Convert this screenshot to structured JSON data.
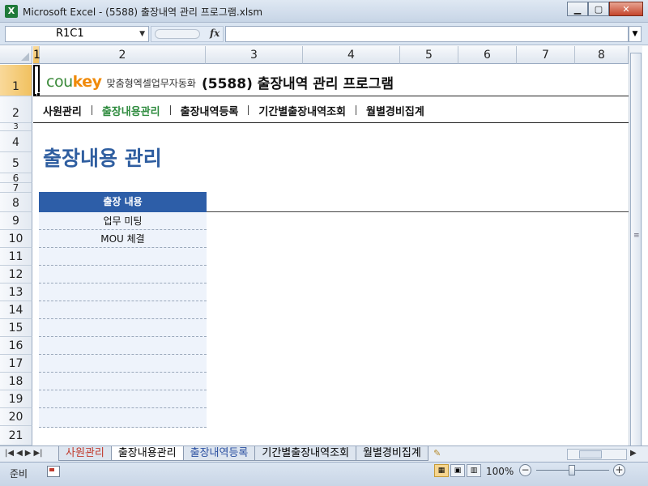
{
  "window": {
    "title": "Microsoft Excel - (5588) 출장내역 관리 프로그램.xlsm",
    "app_icon": "X",
    "min_glyph": "▁",
    "max_glyph": "▢",
    "close_glyph": "✕"
  },
  "formula_bar": {
    "name_box": "R1C1",
    "fx_label": "fx",
    "formula": ""
  },
  "columns": [
    "1",
    "2",
    "3",
    "4",
    "5",
    "6",
    "7",
    "8"
  ],
  "rows": [
    "1",
    "2",
    "3",
    "4",
    "5",
    "6",
    "7",
    "8",
    "9",
    "10",
    "11",
    "12",
    "13",
    "14",
    "15",
    "16",
    "17",
    "18",
    "19",
    "20",
    "21"
  ],
  "header": {
    "logo_cou": "cou",
    "logo_key": "key",
    "logo_tagline": "맞춤형엑셀업무자동화",
    "program_title": "(5588) 출장내역 관리 프로그램"
  },
  "menu": {
    "items": [
      {
        "label": "사원관리",
        "active": false
      },
      {
        "label": "출장내용관리",
        "active": true
      },
      {
        "label": "출장내역등록",
        "active": false
      },
      {
        "label": "기간별출장내역조회",
        "active": false
      },
      {
        "label": "월별경비집계",
        "active": false
      }
    ]
  },
  "page": {
    "title": "출장내용 관리"
  },
  "table": {
    "header": "출장 내용",
    "rows": [
      "업무 미팅",
      "MOU 체결",
      "",
      "",
      "",
      "",
      "",
      "",
      "",
      "",
      "",
      ""
    ]
  },
  "sheet_tabs": [
    {
      "label": "사원관리",
      "active": false
    },
    {
      "label": "출장내용관리",
      "active": true
    },
    {
      "label": "출장내역등록",
      "active": false
    },
    {
      "label": "기간별출장내역조회",
      "active": false
    },
    {
      "label": "월별경비집계",
      "active": false
    }
  ],
  "status": {
    "ready": "준비",
    "zoom": "100%"
  },
  "colors": {
    "accent_green": "#2e8b3e",
    "title_blue": "#2f5ea0",
    "table_header_bg": "#2d5ea8",
    "logo_orange": "#f08a0a"
  }
}
